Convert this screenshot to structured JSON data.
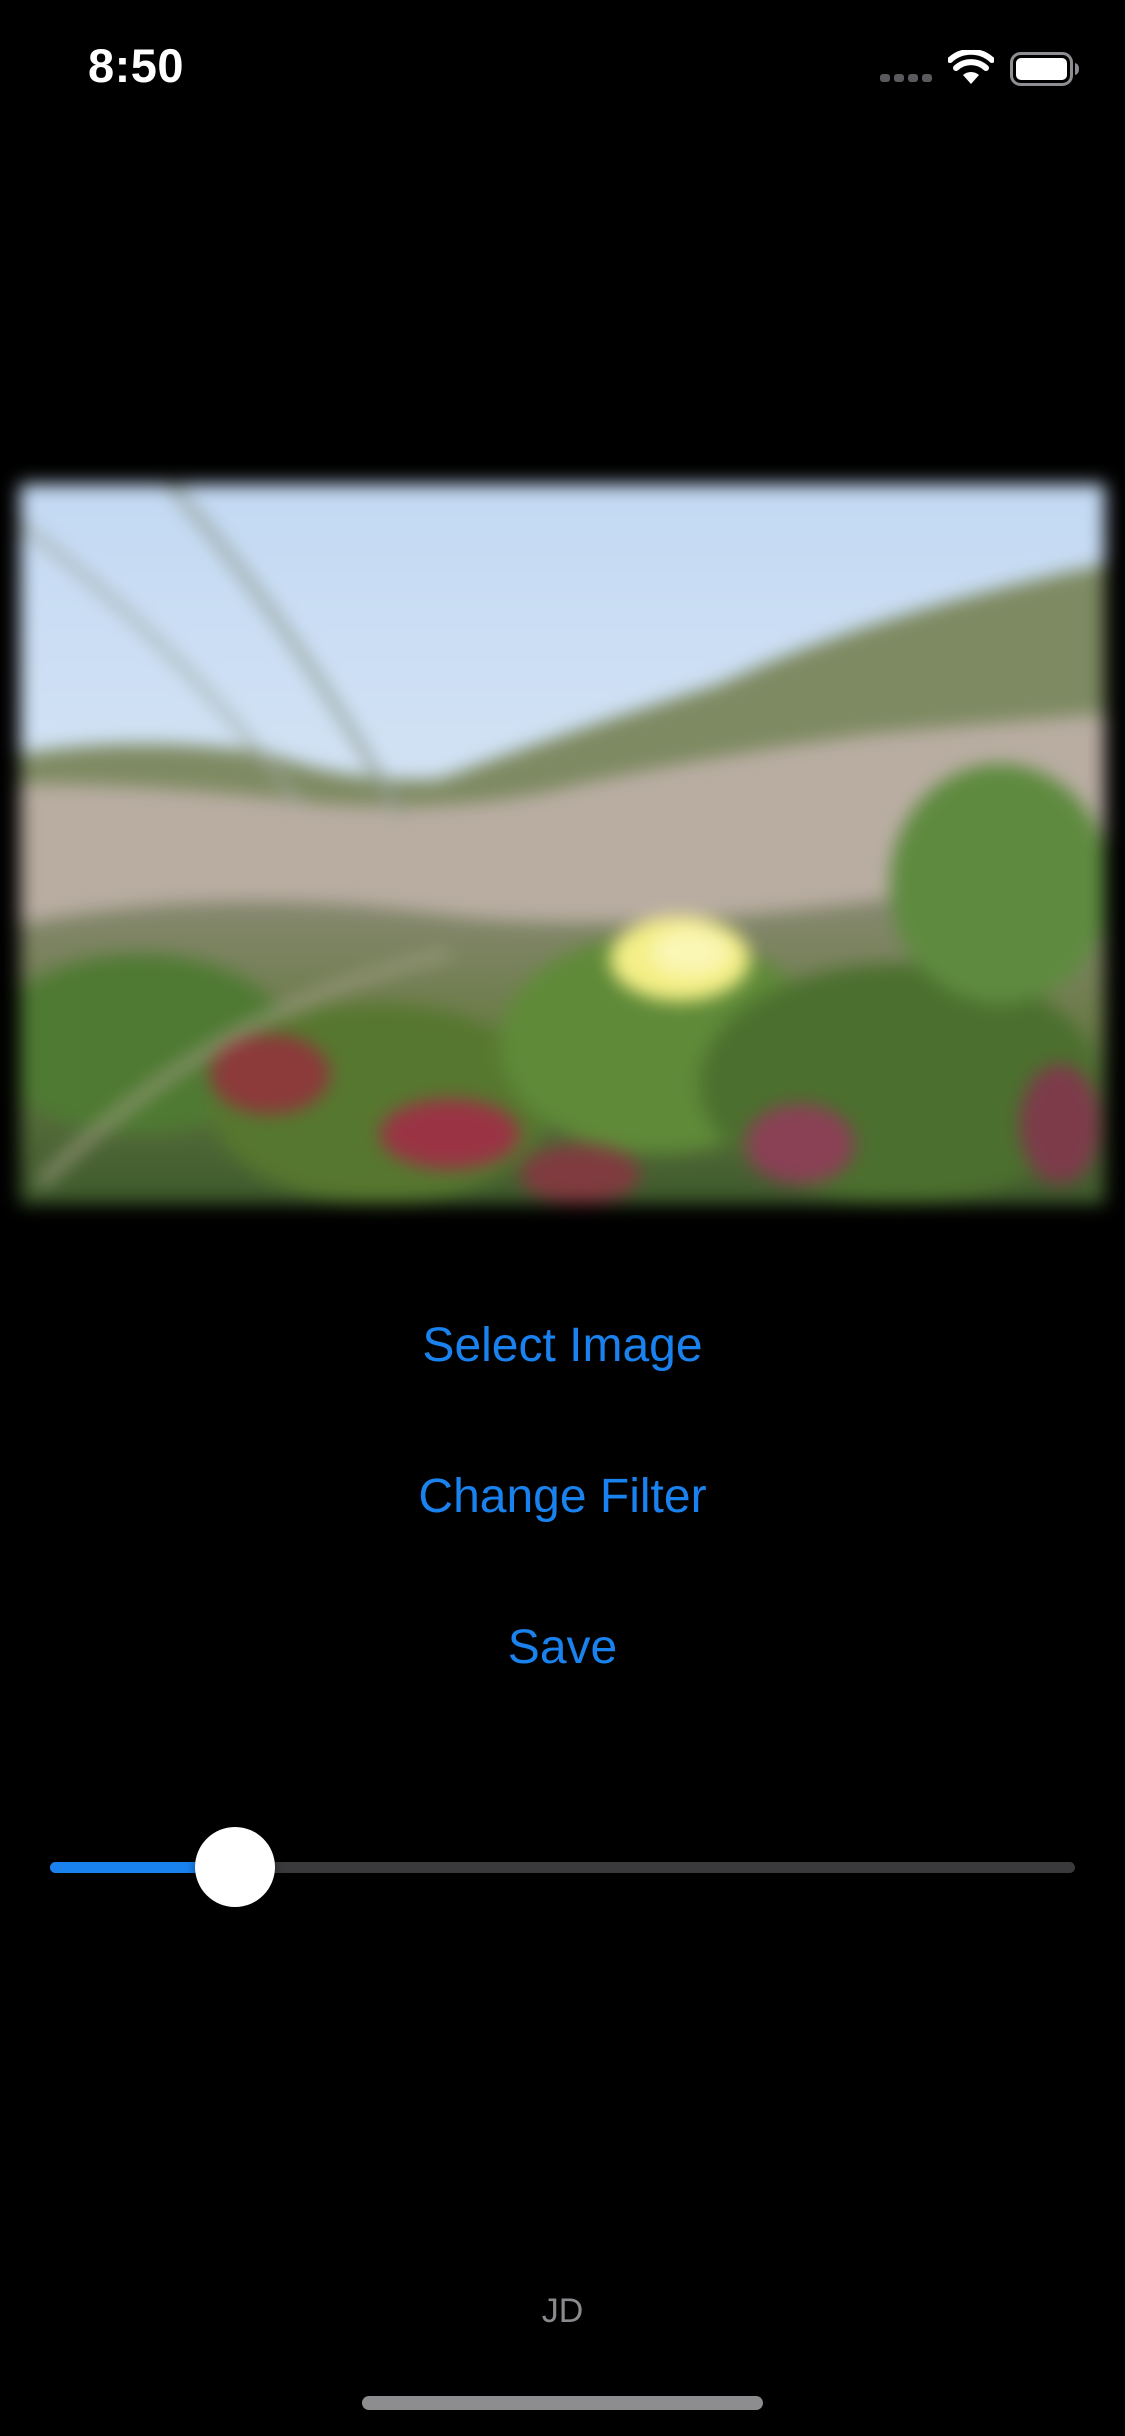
{
  "status_bar": {
    "time": "8:50",
    "icons": [
      "cellular-signal-icon",
      "wifi-icon",
      "battery-icon"
    ]
  },
  "photo": {
    "subject": "blurred photo of a yellow flower among succulent groundcover on a dune"
  },
  "actions": {
    "select_image": "Select Image",
    "change_filter": "Change Filter",
    "save": "Save"
  },
  "intensity_slider": {
    "value": 0.18,
    "min": 0,
    "max": 1
  },
  "footer": {
    "initials": "JD"
  },
  "colors": {
    "background": "#000000",
    "accent": "#1a82ef",
    "track": "#3a3a3c",
    "secondary_text": "#8a8a8e"
  }
}
